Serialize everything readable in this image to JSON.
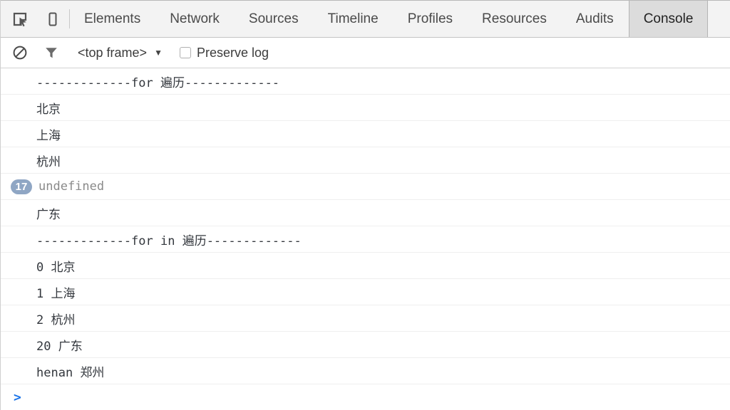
{
  "window": {
    "title": "Chrome DevTools"
  },
  "toolbar": {
    "inspect_icon": "inspect-element-icon",
    "device_icon": "device-toolbar-icon",
    "tabs": [
      {
        "label": "Elements",
        "active": false
      },
      {
        "label": "Network",
        "active": false
      },
      {
        "label": "Sources",
        "active": false
      },
      {
        "label": "Timeline",
        "active": false
      },
      {
        "label": "Profiles",
        "active": false
      },
      {
        "label": "Resources",
        "active": false
      },
      {
        "label": "Audits",
        "active": false
      },
      {
        "label": "Console",
        "active": true
      }
    ]
  },
  "filterbar": {
    "clear_icon": "clear-console-icon",
    "filter_icon": "filter-funnel-icon",
    "frame_selector": {
      "value": "<top frame>",
      "caret": "▼"
    },
    "preserve_log": {
      "label": "Preserve log",
      "checked": false
    }
  },
  "console": {
    "messages": [
      {
        "badge": null,
        "text": "-------------for 遍历-------------",
        "dim": false
      },
      {
        "badge": null,
        "text": "北京",
        "dim": false
      },
      {
        "badge": null,
        "text": "上海",
        "dim": false
      },
      {
        "badge": null,
        "text": "杭州",
        "dim": false
      },
      {
        "badge": "17",
        "text": "undefined",
        "dim": true
      },
      {
        "badge": null,
        "text": "广东",
        "dim": false
      },
      {
        "badge": null,
        "text": "-------------for in 遍历-------------",
        "dim": false
      },
      {
        "badge": null,
        "text": "0 北京",
        "dim": false
      },
      {
        "badge": null,
        "text": "1 上海",
        "dim": false
      },
      {
        "badge": null,
        "text": "2 杭州",
        "dim": false
      },
      {
        "badge": null,
        "text": "20 广东",
        "dim": false
      },
      {
        "badge": null,
        "text": "henan 郑州",
        "dim": false
      }
    ],
    "prompt": {
      "chevron": ">",
      "value": ""
    }
  },
  "colors": {
    "accent_blue": "#1a73e8",
    "badge_bg": "#8fa6c4",
    "text": "#33373d",
    "dim_text": "#8a8a8a",
    "tab_active_bg": "#dcdcdc",
    "tabbar_bg": "#f3f3f3"
  }
}
